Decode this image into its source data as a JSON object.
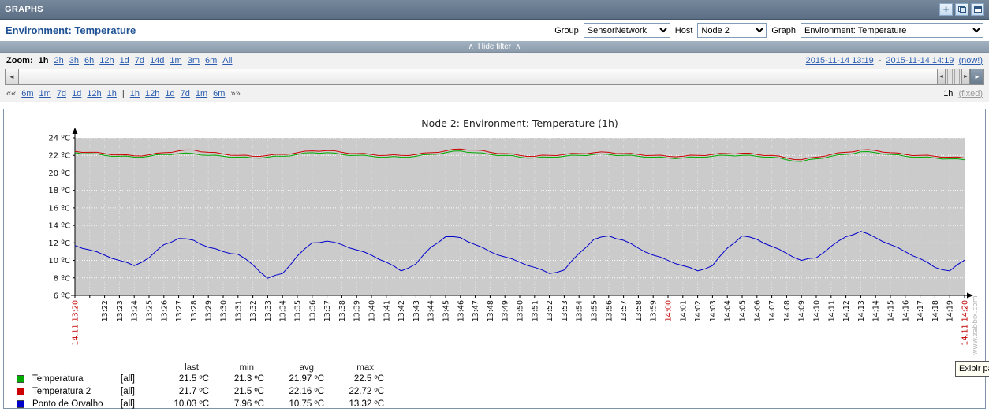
{
  "titlebar": {
    "title": "GRAPHS",
    "add_glyph": "+"
  },
  "header": {
    "title": "Environment: Temperature",
    "group_label": "Group",
    "group_value": "SensorNetwork",
    "host_label": "Host",
    "host_value": "Node 2",
    "graph_label": "Graph",
    "graph_value": "Environment: Temperature"
  },
  "filter": {
    "toggle_arrow": "∧",
    "toggle_label": "Hide filter",
    "zoom_label": "Zoom:",
    "zoom_selected": "1h",
    "zoom_options": [
      "2h",
      "3h",
      "6h",
      "12h",
      "1d",
      "7d",
      "14d",
      "1m",
      "3m",
      "6m",
      "All"
    ],
    "date_from": "2015-11-14 13:19",
    "date_separator": "-",
    "date_to": "2015-11-14 14:19",
    "now_link": "(now!)",
    "scroll_left_glyph": "◄",
    "scroll_right_glyph": "►",
    "thumb_left_glyph": "◄",
    "thumb_right_glyph": "►",
    "prev_arrows": "««",
    "nav_left": [
      "6m",
      "1m",
      "7d",
      "1d",
      "12h",
      "1h"
    ],
    "divider": "|",
    "nav_right": [
      "1h",
      "12h",
      "1d",
      "7d",
      "1m",
      "6m"
    ],
    "next_arrows": "»»",
    "period_value": "1h",
    "fixed_link": "(fixed)"
  },
  "chart_data": {
    "type": "line",
    "title": "Node 2: Environment: Temperature (1h)",
    "ylim": [
      6,
      24
    ],
    "ytick_step": 2,
    "yticks": [
      "24 ºC",
      "22 ºC",
      "20 ºC",
      "18 ºC",
      "16 ºC",
      "14 ºC",
      "12 ºC",
      "10 ºC",
      "8 ºC",
      "6 ºC"
    ],
    "x_minutes_total": 60,
    "plot_bg": "#cbcbcb",
    "grid": true,
    "watermark": "www.zabbix.com",
    "x_ticks": [
      [
        0,
        "14.11 13:20",
        1
      ],
      [
        2,
        "13:22",
        0
      ],
      [
        3,
        "13:23",
        0
      ],
      [
        4,
        "13:24",
        0
      ],
      [
        5,
        "13:25",
        0
      ],
      [
        6,
        "13:26",
        0
      ],
      [
        7,
        "13:27",
        0
      ],
      [
        8,
        "13:28",
        0
      ],
      [
        9,
        "13:29",
        0
      ],
      [
        10,
        "13:30",
        0
      ],
      [
        11,
        "13:31",
        0
      ],
      [
        12,
        "13:32",
        0
      ],
      [
        13,
        "13:33",
        0
      ],
      [
        14,
        "13:34",
        0
      ],
      [
        15,
        "13:35",
        0
      ],
      [
        16,
        "13:36",
        0
      ],
      [
        17,
        "13:37",
        0
      ],
      [
        18,
        "13:38",
        0
      ],
      [
        19,
        "13:39",
        0
      ],
      [
        20,
        "13:40",
        0
      ],
      [
        21,
        "13:41",
        0
      ],
      [
        22,
        "13:42",
        0
      ],
      [
        23,
        "13:43",
        0
      ],
      [
        24,
        "13:44",
        0
      ],
      [
        25,
        "13:45",
        0
      ],
      [
        26,
        "13:46",
        0
      ],
      [
        27,
        "13:47",
        0
      ],
      [
        28,
        "13:48",
        0
      ],
      [
        29,
        "13:49",
        0
      ],
      [
        30,
        "13:50",
        0
      ],
      [
        31,
        "13:51",
        0
      ],
      [
        32,
        "13:52",
        0
      ],
      [
        33,
        "13:53",
        0
      ],
      [
        34,
        "13:54",
        0
      ],
      [
        35,
        "13:55",
        0
      ],
      [
        36,
        "13:56",
        0
      ],
      [
        37,
        "13:57",
        0
      ],
      [
        38,
        "13:58",
        0
      ],
      [
        39,
        "13:59",
        0
      ],
      [
        40,
        "14:00",
        1
      ],
      [
        41,
        "14:01",
        0
      ],
      [
        42,
        "14:02",
        0
      ],
      [
        43,
        "14:03",
        0
      ],
      [
        44,
        "14:04",
        0
      ],
      [
        45,
        "14:05",
        0
      ],
      [
        46,
        "14:06",
        0
      ],
      [
        47,
        "14:07",
        0
      ],
      [
        48,
        "14:08",
        0
      ],
      [
        49,
        "14:09",
        0
      ],
      [
        50,
        "14:10",
        0
      ],
      [
        51,
        "14:11",
        0
      ],
      [
        52,
        "14:12",
        0
      ],
      [
        53,
        "14:13",
        0
      ],
      [
        54,
        "14:14",
        0
      ],
      [
        55,
        "14:15",
        0
      ],
      [
        56,
        "14:16",
        0
      ],
      [
        57,
        "14:17",
        0
      ],
      [
        58,
        "14:18",
        0
      ],
      [
        59,
        "14:19",
        0
      ],
      [
        60,
        "14.11 14:20",
        1
      ]
    ],
    "series": [
      {
        "name": "Temperatura",
        "color": "#00AA00",
        "values": [
          22.3,
          22.2,
          22.0,
          21.9,
          21.8,
          21.9,
          22.1,
          22.2,
          22.2,
          22.0,
          21.9,
          21.8,
          21.7,
          21.8,
          21.9,
          22.1,
          22.3,
          22.3,
          22.1,
          22.0,
          21.9,
          21.8,
          21.8,
          21.9,
          22.1,
          22.3,
          22.5,
          22.3,
          22.1,
          22.0,
          21.8,
          21.7,
          21.8,
          21.9,
          22.0,
          22.1,
          22.1,
          22.0,
          21.9,
          21.8,
          21.7,
          21.7,
          21.8,
          21.9,
          22.0,
          22.0,
          21.9,
          21.8,
          21.5,
          21.3,
          21.6,
          21.9,
          22.1,
          22.4,
          22.3,
          22.1,
          21.9,
          21.8,
          21.7,
          21.6,
          21.5
        ]
      },
      {
        "name": "Temperatura 2",
        "color": "#CC0000",
        "values": [
          22.45,
          22.35,
          22.2,
          22.05,
          21.95,
          22.05,
          22.3,
          22.5,
          22.6,
          22.35,
          22.15,
          22.0,
          21.9,
          22.0,
          22.1,
          22.3,
          22.5,
          22.55,
          22.35,
          22.2,
          22.1,
          22.0,
          22.0,
          22.1,
          22.3,
          22.5,
          22.72,
          22.6,
          22.35,
          22.2,
          22.0,
          21.9,
          22.0,
          22.1,
          22.2,
          22.3,
          22.35,
          22.2,
          22.1,
          22.0,
          21.9,
          21.9,
          22.0,
          22.1,
          22.2,
          22.25,
          22.1,
          22.0,
          21.7,
          21.5,
          21.8,
          22.1,
          22.35,
          22.6,
          22.55,
          22.3,
          22.1,
          22.0,
          21.9,
          21.8,
          21.7
        ]
      },
      {
        "name": "Ponto de Orvalho",
        "color": "#0000CC",
        "values": [
          11.7,
          11.2,
          10.6,
          10.0,
          9.4,
          10.3,
          11.8,
          12.5,
          12.3,
          11.5,
          11.0,
          10.7,
          9.5,
          7.96,
          8.5,
          10.5,
          12.0,
          12.2,
          11.8,
          11.2,
          10.6,
          9.8,
          8.8,
          9.6,
          11.5,
          12.7,
          12.6,
          11.8,
          11.0,
          10.4,
          9.8,
          9.2,
          8.5,
          8.9,
          10.8,
          12.4,
          12.8,
          12.3,
          11.4,
          10.6,
          10.0,
          9.4,
          8.8,
          9.4,
          11.4,
          12.8,
          12.4,
          11.6,
          10.8,
          10.0,
          10.3,
          11.6,
          12.7,
          13.32,
          12.6,
          11.8,
          11.0,
          10.2,
          9.2,
          8.8,
          10.03
        ]
      }
    ],
    "legend": {
      "headers": [
        "last",
        "min",
        "avg",
        "max"
      ],
      "rows": [
        {
          "name": "Temperatura",
          "scope": "[all]",
          "color": "#00AA00",
          "values": [
            "21.5 ºC",
            "21.3 ºC",
            "21.97 ºC",
            "22.5 ºC"
          ]
        },
        {
          "name": "Temperatura 2",
          "scope": "[all]",
          "color": "#CC0000",
          "values": [
            "21.7 ºC",
            "21.5 ºC",
            "22.16 ºC",
            "22.72 ºC"
          ]
        },
        {
          "name": "Ponto de Orvalho",
          "scope": "[all]",
          "color": "#0000CC",
          "values": [
            "10.03 ºC",
            "7.96 ºC",
            "10.75 ºC",
            "13.32 ºC"
          ]
        }
      ]
    }
  },
  "tooltip": {
    "text": "Exibir pa"
  }
}
